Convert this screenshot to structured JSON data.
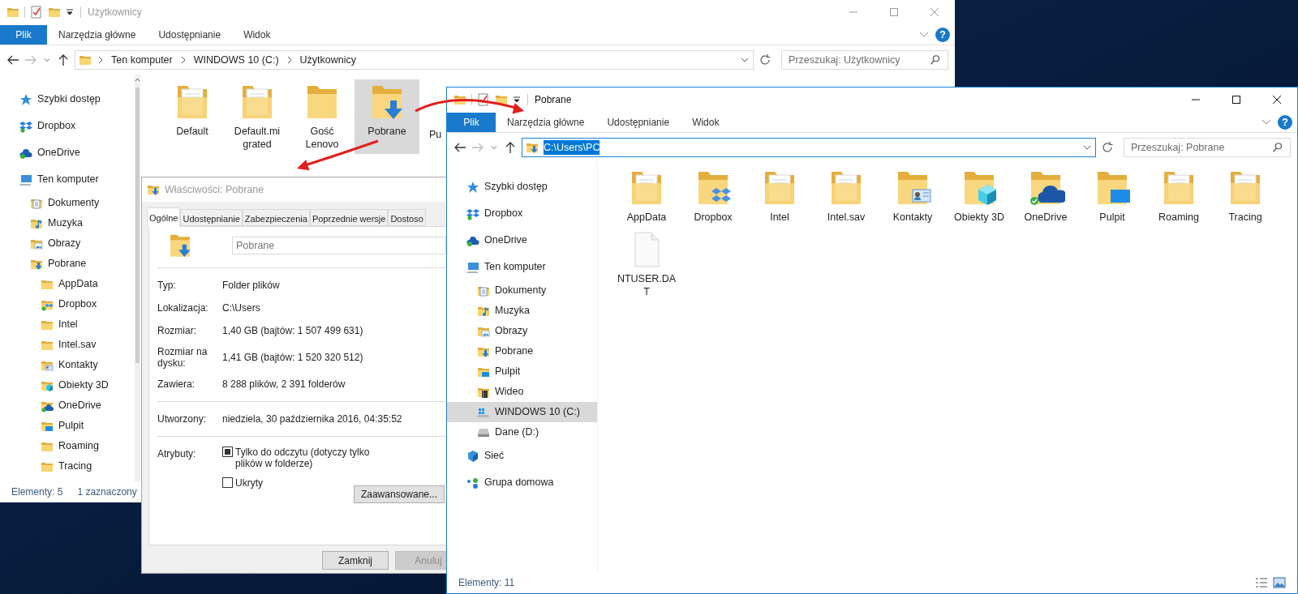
{
  "back_window": {
    "title": "Użytkownicy",
    "file_tab": "Plik",
    "ribbon_tabs": [
      "Narzędzia główne",
      "Udostępnianie",
      "Widok"
    ],
    "help": "?",
    "breadcrumb": [
      "Ten komputer",
      "WINDOWS 10 (C:)",
      "Użytkownicy"
    ],
    "search": {
      "placeholder": "Przeszukaj: Użytkownicy"
    },
    "sidebar": [
      {
        "label": "Szybki dostęp",
        "kind": "star",
        "selected": false
      },
      {
        "label": "Dropbox",
        "kind": "dropbox",
        "selected": false
      },
      {
        "label": "OneDrive",
        "kind": "onedrive",
        "selected": false
      },
      {
        "label": "Ten komputer",
        "kind": "computer",
        "selected": false,
        "children": [
          {
            "label": "Dokumenty",
            "kind": "documents",
            "selected": false
          },
          {
            "label": "Muzyka",
            "kind": "music",
            "selected": false
          },
          {
            "label": "Obrazy",
            "kind": "pictures",
            "selected": false
          },
          {
            "label": "Pobrane",
            "kind": "download",
            "selected": false,
            "children": [
              {
                "label": "AppData",
                "kind": "folder",
                "selected": false
              },
              {
                "label": "Dropbox",
                "kind": "dropbox-folder",
                "selected": false
              },
              {
                "label": "Intel",
                "kind": "folder",
                "selected": false
              },
              {
                "label": "Intel.sav",
                "kind": "folder",
                "selected": false
              },
              {
                "label": "Kontakty",
                "kind": "contacts",
                "selected": false
              },
              {
                "label": "Obiekty 3D",
                "kind": "cube",
                "selected": false
              },
              {
                "label": "OneDrive",
                "kind": "onedrive-folder",
                "selected": false
              },
              {
                "label": "Pulpit",
                "kind": "desktop",
                "selected": false
              },
              {
                "label": "Roaming",
                "kind": "folder",
                "selected": false
              },
              {
                "label": "Tracing",
                "kind": "folder",
                "selected": false
              }
            ]
          }
        ]
      }
    ],
    "items": [
      {
        "label": "Default",
        "kind": "doc",
        "selected": false
      },
      {
        "label": "Default.migrated",
        "kind": "doc",
        "selected": false
      },
      {
        "label": "Gość Lenovo",
        "kind": "plain",
        "selected": false
      },
      {
        "label": "Pobrane",
        "kind": "download",
        "selected": true
      },
      {
        "label": "Pu",
        "selected": false,
        "clipped": true
      }
    ],
    "status_bar": [
      "Elementy: 5",
      "1 zaznaczony"
    ]
  },
  "properties_dialog": {
    "title": "Właściwości: Pobrane",
    "tabs": [
      {
        "label": "Ogólne",
        "selected": true
      },
      {
        "label": "Udostępnianie",
        "selected": false
      },
      {
        "label": "Zabezpieczenia",
        "selected": false
      },
      {
        "label": "Poprzednie wersje",
        "selected": false
      },
      {
        "label": "Dostoso",
        "selected": false
      }
    ],
    "name": "Pobrane",
    "sections": [
      [
        {
          "label": "Typ:",
          "value": "Folder plików"
        },
        {
          "label": "Lokalizacja:",
          "value": "C:\\Users"
        },
        {
          "label": "Rozmiar:",
          "value": "1,40 GB (bajtów: 1 507 499 631)"
        },
        {
          "label": "Rozmiar na dysku:",
          "value": "1,41 GB (bajtów: 1 520 320 512)"
        },
        {
          "label": "Zawiera:",
          "value": "8 288 plików, 2 391 folderów"
        }
      ],
      [
        {
          "label": "Utworzony:",
          "value": "niedziela, 30 października 2016, 04:35:52"
        }
      ]
    ],
    "attributes_label": "Atrybuty:",
    "attributes": [
      {
        "label": "Tylko do odczytu (dotyczy tylko plików w folderze)",
        "checked": false,
        "indeterminate": true
      },
      {
        "label": "Ukryty",
        "checked": false,
        "indeterminate": false
      }
    ],
    "advanced_button": "Zaawansowane...",
    "buttons": [
      {
        "label": "Zamknij",
        "disabled": false
      },
      {
        "label": "Anuluj",
        "disabled": true
      }
    ]
  },
  "front_window": {
    "title": "Pobrane",
    "file_tab": "Plik",
    "ribbon_tabs": [
      "Narzędzia główne",
      "Udostępnianie",
      "Widok"
    ],
    "help": "?",
    "address": {
      "value": "C:\\Users\\PC",
      "text_selected": true
    },
    "search": {
      "placeholder": "Przeszukaj: Pobrane"
    },
    "sidebar": [
      {
        "label": "Szybki dostęp",
        "kind": "star",
        "selected": false
      },
      {
        "label": "Dropbox",
        "kind": "dropbox",
        "selected": false
      },
      {
        "label": "OneDrive",
        "kind": "onedrive",
        "selected": false
      },
      {
        "label": "Ten komputer",
        "kind": "computer",
        "selected": false,
        "children": [
          {
            "label": "Dokumenty",
            "kind": "documents",
            "selected": false
          },
          {
            "label": "Muzyka",
            "kind": "music",
            "selected": false
          },
          {
            "label": "Obrazy",
            "kind": "pictures",
            "selected": false
          },
          {
            "label": "Pobrane",
            "kind": "download",
            "selected": false
          },
          {
            "label": "Pulpit",
            "kind": "desktop",
            "selected": false
          },
          {
            "label": "Wideo",
            "kind": "video",
            "selected": false
          },
          {
            "label": "WINDOWS 10 (C:)",
            "kind": "system-drive",
            "selected": true
          },
          {
            "label": "Dane (D:)",
            "kind": "drive",
            "selected": false
          }
        ]
      },
      {
        "label": "Sieć",
        "kind": "network",
        "selected": false
      },
      {
        "label": "Grupa domowa",
        "kind": "homegroup",
        "selected": false
      }
    ],
    "items": [
      {
        "label": "AppData",
        "kind": "doc",
        "selected": false
      },
      {
        "label": "Dropbox",
        "kind": "dropbox",
        "selected": false
      },
      {
        "label": "Intel",
        "kind": "doc",
        "selected": false
      },
      {
        "label": "Intel.sav",
        "kind": "doc",
        "selected": false
      },
      {
        "label": "Kontakty",
        "kind": "contacts",
        "selected": false
      },
      {
        "label": "Obiekty 3D",
        "kind": "cube",
        "selected": false
      },
      {
        "label": "OneDrive",
        "kind": "cloud",
        "selected": false
      },
      {
        "label": "Pulpit",
        "kind": "desktop",
        "selected": false
      },
      {
        "label": "Roaming",
        "kind": "doc",
        "selected": false
      },
      {
        "label": "Tracing",
        "kind": "doc",
        "selected": false
      },
      {
        "label": "NTUSER.DAT",
        "kind": "file",
        "selected": false
      }
    ],
    "status_bar": [
      "Elementy: 11"
    ]
  }
}
